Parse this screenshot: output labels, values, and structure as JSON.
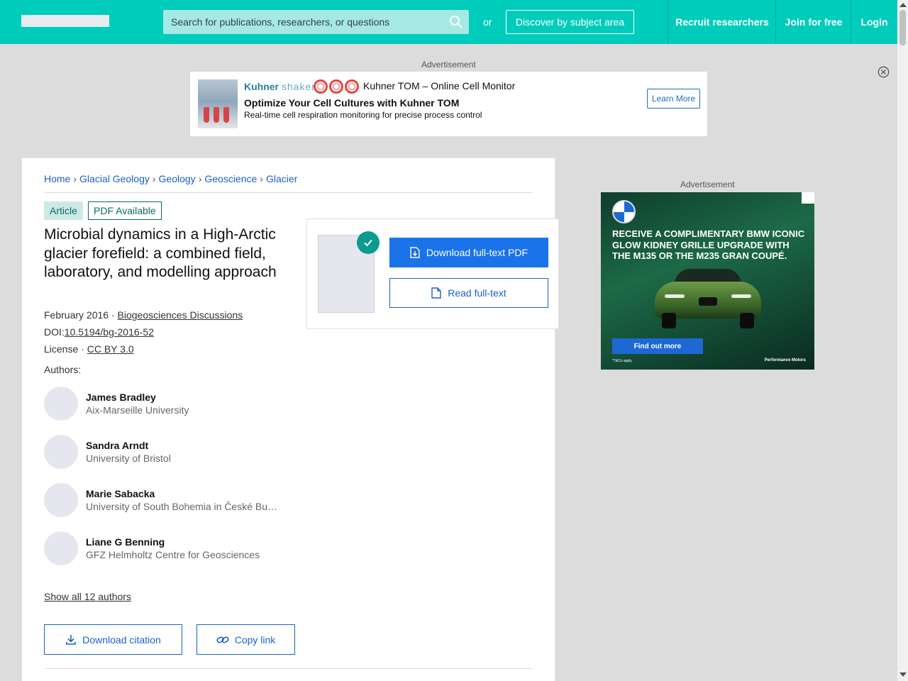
{
  "header": {
    "search_placeholder": "Search for publications, researchers, or questions",
    "or_text": "or",
    "discover_label": "Discover by subject area",
    "nav": {
      "recruit": "Recruit researchers",
      "join": "Join for free",
      "login": "Login"
    }
  },
  "top_ad": {
    "label": "Advertisement",
    "brand": "Kuhner",
    "brand_light": "shaker",
    "product": "Kuhner TOM – Online Cell Monitor",
    "headline": "Optimize Your Cell Cultures with Kuhner TOM",
    "sub": "Real-time cell respiration monitoring for precise process control",
    "cta": "Learn More"
  },
  "breadcrumb": [
    "Home",
    "Glacial Geology",
    "Geology",
    "Geoscience",
    "Glacier"
  ],
  "article": {
    "type_badge": "Article",
    "pdf_badge": "PDF Available",
    "title": "Microbial dynamics in a High-Arctic glacier forefield: a combined field, laboratory, and modelling approach",
    "date": "February 2016",
    "journal": "Biogeosciences Discussions",
    "doi_label": "DOI:",
    "doi": "10.5194/bg-2016-52",
    "license_label": "License",
    "license": "CC BY 3.0",
    "authors_label": "Authors:",
    "authors": [
      {
        "name": "James Bradley",
        "affiliation": "Aix-Marseille University"
      },
      {
        "name": "Sandra Arndt",
        "affiliation": "University of Bristol"
      },
      {
        "name": "Marie Sabacka",
        "affiliation": "University of South Bohemia in České Budějovice"
      },
      {
        "name": "Liane G Benning",
        "affiliation": "GFZ Helmholtz Centre for Geosciences"
      }
    ],
    "show_all": "Show all 12 authors",
    "download_citation": "Download citation",
    "copy_link": "Copy link"
  },
  "pdf_panel": {
    "download_pdf": "Download full-text PDF",
    "read_full": "Read full-text"
  },
  "side_ad": {
    "label": "Advertisement",
    "headline": "RECEIVE A COMPLIMENTARY BMW ICONIC GLOW KIDNEY GRILLE UPGRADE WITH THE M135 OR THE M235 GRAN COUPÉ.",
    "cta": "Find out more",
    "terms": "*T&Cs apply",
    "dealer": "Performance Motors"
  },
  "colors": {
    "header_bg": "#00ccbb",
    "link": "#1a62c5",
    "primary_button": "#1a73e8",
    "badge_bg": "#cde9e6",
    "check_bg": "#0c9c8f"
  }
}
